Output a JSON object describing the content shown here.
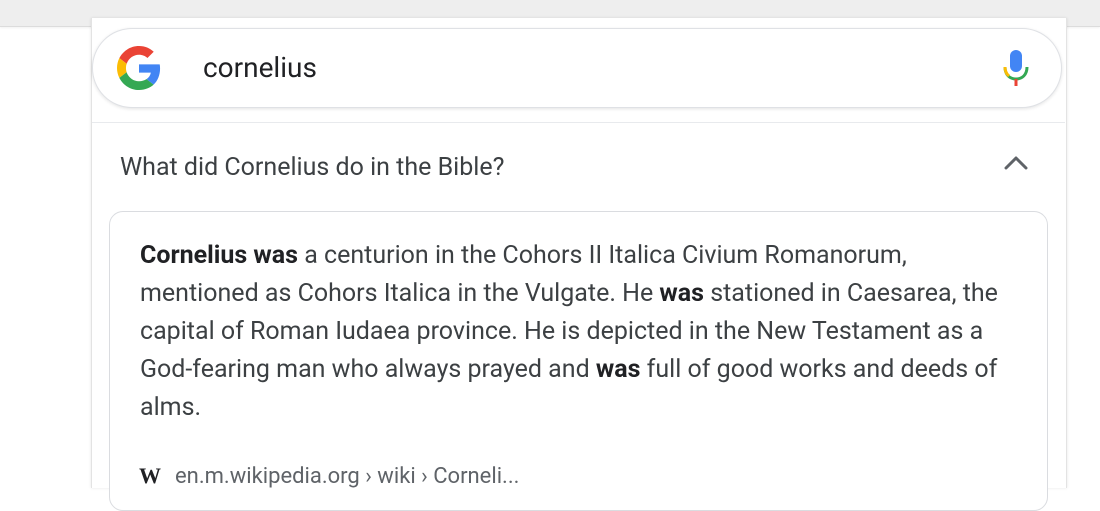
{
  "search": {
    "query": "cornelius"
  },
  "icons": {
    "logo": "google-g-icon",
    "mic": "microphone-icon",
    "chevron": "chevron-up-icon",
    "source": "wikipedia-icon"
  },
  "question": {
    "text": "What did Cornelius do in the Bible?"
  },
  "answer": {
    "segments": [
      {
        "t": "Cornelius was",
        "b": true
      },
      {
        "t": " a centurion in the Cohors II Italica Civium Romanorum, mentioned as Cohors Italica in the Vulgate. He ",
        "b": false
      },
      {
        "t": "was",
        "b": true
      },
      {
        "t": " stationed in Caesarea, the capital of Roman Iudaea province. He is depicted in the New Testament as a God-fearing man who always prayed and ",
        "b": false
      },
      {
        "t": "was",
        "b": true
      },
      {
        "t": " full of good works and deeds of alms.",
        "b": false
      }
    ]
  },
  "source": {
    "badge": "W",
    "url": "en.m.wikipedia.org › wiki › Corneli..."
  },
  "colors": {
    "google_blue": "#4285F4",
    "google_red": "#EA4335",
    "google_yellow": "#FBBC05",
    "google_green": "#34A853"
  }
}
